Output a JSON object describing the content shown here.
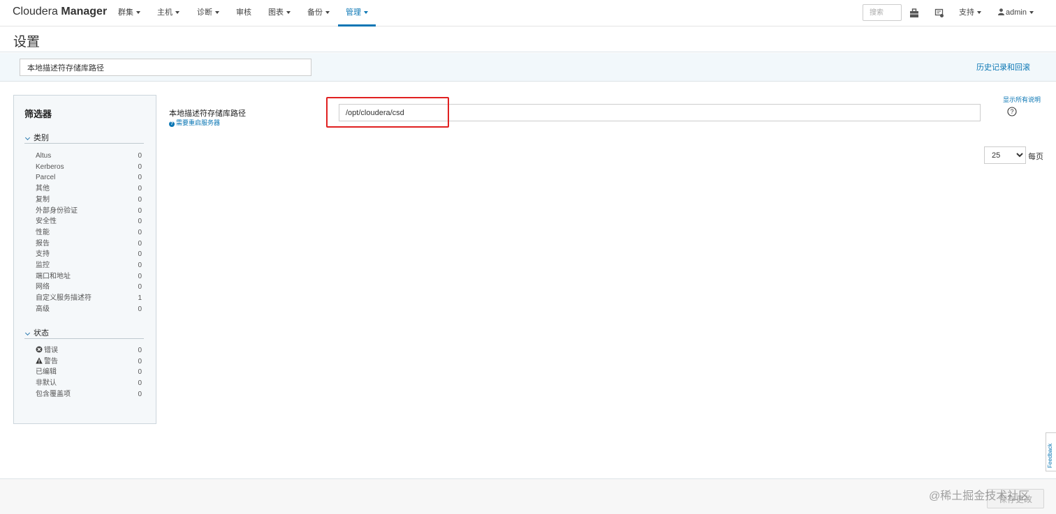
{
  "header": {
    "brand_light": "Cloudera ",
    "brand_bold": "Manager",
    "nav": [
      {
        "label": "群集",
        "dropdown": true
      },
      {
        "label": "主机",
        "dropdown": true
      },
      {
        "label": "诊断",
        "dropdown": true
      },
      {
        "label": "审核",
        "dropdown": false
      },
      {
        "label": "图表",
        "dropdown": true
      },
      {
        "label": "备份",
        "dropdown": true
      },
      {
        "label": "管理",
        "dropdown": true,
        "active": true
      }
    ],
    "search_placeholder": "搜索",
    "support_label": "支持",
    "user_label": "admin"
  },
  "page": {
    "title": "设置",
    "filter_value": "本地描述符存储库路径",
    "history_link": "历史记录和回滚"
  },
  "sidebar": {
    "title": "筛选器",
    "category_header": "类别",
    "categories": [
      {
        "label": "Altus",
        "count": "0"
      },
      {
        "label": "Kerberos",
        "count": "0"
      },
      {
        "label": "Parcel",
        "count": "0"
      },
      {
        "label": "其他",
        "count": "0"
      },
      {
        "label": "复制",
        "count": "0"
      },
      {
        "label": "外部身份验证",
        "count": "0"
      },
      {
        "label": "安全性",
        "count": "0"
      },
      {
        "label": "性能",
        "count": "0"
      },
      {
        "label": "报告",
        "count": "0"
      },
      {
        "label": "支持",
        "count": "0"
      },
      {
        "label": "监控",
        "count": "0"
      },
      {
        "label": "端口和地址",
        "count": "0"
      },
      {
        "label": "网络",
        "count": "0"
      },
      {
        "label": "自定义服务描述符",
        "count": "1"
      },
      {
        "label": "高级",
        "count": "0"
      }
    ],
    "status_header": "状态",
    "statuses": [
      {
        "label": "错误",
        "count": "0",
        "icon": "error-icon"
      },
      {
        "label": "警告",
        "count": "0",
        "icon": "warning-icon"
      },
      {
        "label": "已编辑",
        "count": "0"
      },
      {
        "label": "非默认",
        "count": "0"
      },
      {
        "label": "包含覆盖项",
        "count": "0"
      }
    ]
  },
  "setting": {
    "label": "本地描述符存储库路径",
    "restart_note": "需要重启服务器",
    "value": "/opt/cloudera/csd",
    "show_all_descriptions": "显示所有说明"
  },
  "pagination": {
    "per_page_value": "25",
    "per_page_label": "每页"
  },
  "footer": {
    "save_label": "保存更改",
    "watermark": "@稀土掘金技术社区"
  },
  "feedback_label": "Feedback",
  "colors": {
    "accent": "#0a76b4",
    "highlight": "#e02020"
  }
}
